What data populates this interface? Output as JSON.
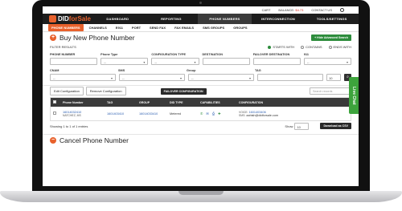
{
  "util_bar": {
    "cart": "CART",
    "balance_label": "BALANCE:",
    "balance_value": "$4.73",
    "contact": "CONTACT US"
  },
  "brand": {
    "logo_prefix": "DID",
    "logo_accent": "forSale"
  },
  "nav": [
    {
      "label": "DASHBOARD"
    },
    {
      "label": "REPORTING"
    },
    {
      "label": "PHONE NUMBERS"
    },
    {
      "label": "INTERCONNECTION"
    },
    {
      "label": "TOOLS/SETTINGS"
    }
  ],
  "subnav": [
    "PHONE NUMBERS",
    "CHANNELS",
    "E911",
    "PORT",
    "SEND FAX",
    "FAX EMAILS",
    "SMS GROUPS",
    "GROUPS"
  ],
  "buy_section": {
    "icon": "plus-circle-icon",
    "title": "Buy New Phone Number",
    "advanced_search": "+ Hide Advanced Search"
  },
  "filter": {
    "label": "FILTER RESULTS",
    "options": [
      {
        "label": "STARTS WITH",
        "selected": true
      },
      {
        "label": "CONTAINS",
        "selected": false
      },
      {
        "label": "ENDS WITH",
        "selected": false
      }
    ]
  },
  "form_row1": {
    "labels": [
      "PHONE NUMBER",
      "Phone Type",
      "CONFIGURATION TYPE",
      "DESTINATION",
      "FAILOVER DESTINATION",
      "911"
    ],
    "values": [
      "",
      "--",
      "--",
      "",
      "",
      "--"
    ]
  },
  "form_row2": {
    "labels": [
      "CNAM",
      "SMS",
      "Group",
      "TAG"
    ],
    "values": [
      "--",
      "--",
      "--",
      ""
    ],
    "page_size": "10"
  },
  "table_tools": {
    "edit": "Edit Configuration",
    "remove": "Remove Configuration",
    "failover": "FAILOVER CONFIGURATION",
    "search_placeholder": "Search records"
  },
  "table": {
    "headers": [
      "Phone Number",
      "TAG",
      "GROUP",
      "DID TYPE",
      "CAPABILITIES",
      "CONFIGURATION"
    ],
    "rows": [
      {
        "phone": "16014032410",
        "location": "NATCHEZ, MS",
        "tag": "1601403410",
        "group": "16014033410",
        "did_type": "Metered",
        "config_voice_label": "VOICE:",
        "config_voice": "1601403406",
        "config_sms_label": "SMS:",
        "config_sms": "aahish@didforsale.com"
      }
    ]
  },
  "footer": {
    "entries": "Showing 1 to 1 of 1 entries",
    "show_label": "Show",
    "show_value": "10",
    "download": "Download as CSV"
  },
  "cancel_section": {
    "icon": "minus-circle-icon",
    "title": "Cancel Phone Number"
  },
  "live_chat": "Live Chat",
  "colors": {
    "accent": "#e8612c",
    "green": "#2d8c3c",
    "dark": "#1d1d1d"
  }
}
